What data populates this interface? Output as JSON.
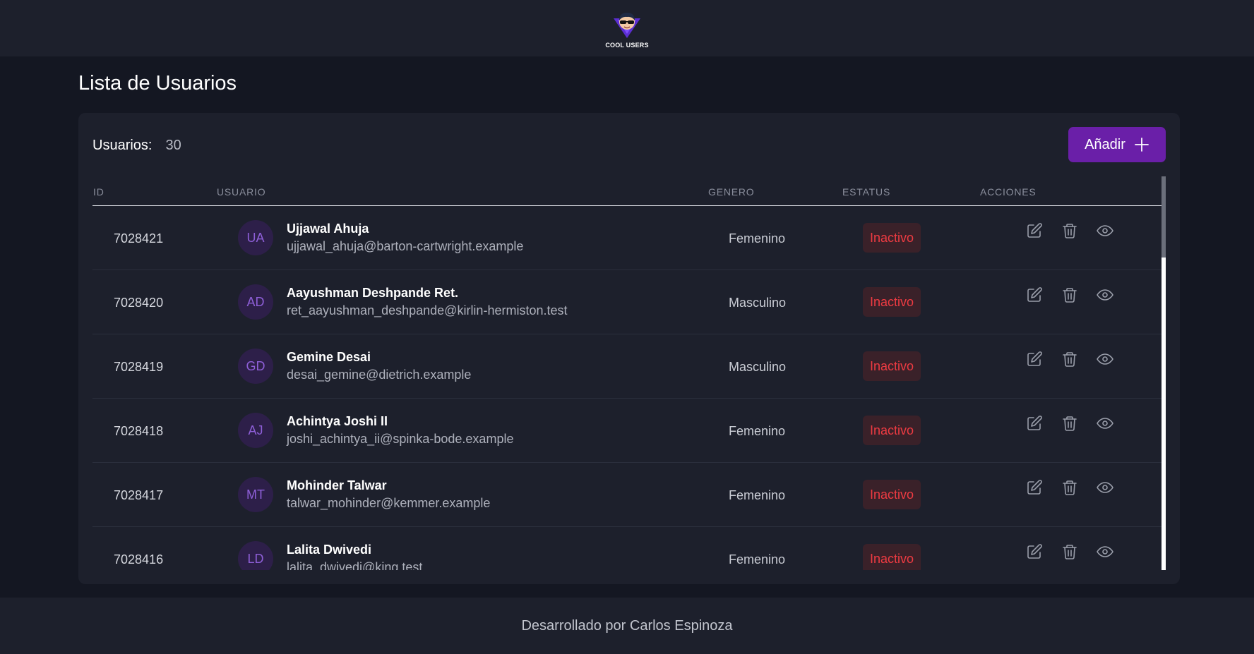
{
  "header": {
    "logo_text": "COOL USERS"
  },
  "page": {
    "title": "Lista de Usuarios"
  },
  "summary": {
    "label": "Usuarios:",
    "count": "30"
  },
  "add_button": {
    "label": "Añadir"
  },
  "table": {
    "columns": {
      "id": "ID",
      "user": "USUARIO",
      "gender": "GENERO",
      "status": "ESTATUS",
      "actions": "ACCIONES"
    },
    "rows": [
      {
        "id": "7028421",
        "initials": "UA",
        "name": "Ujjawal Ahuja",
        "email": "ujjawal_ahuja@barton-cartwright.example",
        "gender": "Femenino",
        "status": "Inactivo"
      },
      {
        "id": "7028420",
        "initials": "AD",
        "name": "Aayushman Deshpande Ret.",
        "email": "ret_aayushman_deshpande@kirlin-hermiston.test",
        "gender": "Masculino",
        "status": "Inactivo"
      },
      {
        "id": "7028419",
        "initials": "GD",
        "name": "Gemine Desai",
        "email": "desai_gemine@dietrich.example",
        "gender": "Masculino",
        "status": "Inactivo"
      },
      {
        "id": "7028418",
        "initials": "AJ",
        "name": "Achintya Joshi II",
        "email": "joshi_achintya_ii@spinka-bode.example",
        "gender": "Femenino",
        "status": "Inactivo"
      },
      {
        "id": "7028417",
        "initials": "MT",
        "name": "Mohinder Talwar",
        "email": "talwar_mohinder@kemmer.example",
        "gender": "Femenino",
        "status": "Inactivo"
      },
      {
        "id": "7028416",
        "initials": "LD",
        "name": "Lalita Dwivedi",
        "email": "lalita_dwivedi@king.test",
        "gender": "Femenino",
        "status": "Inactivo"
      }
    ]
  },
  "footer": {
    "text": "Desarrollado por Carlos Espinoza"
  },
  "colors": {
    "accent": "#6a1fa8",
    "status_inactive": "#ef3b42",
    "background": "#141722",
    "surface": "#1d202c"
  },
  "icons": {
    "edit": "edit-icon",
    "delete": "trash-icon",
    "view": "eye-icon",
    "add": "plus-icon"
  }
}
